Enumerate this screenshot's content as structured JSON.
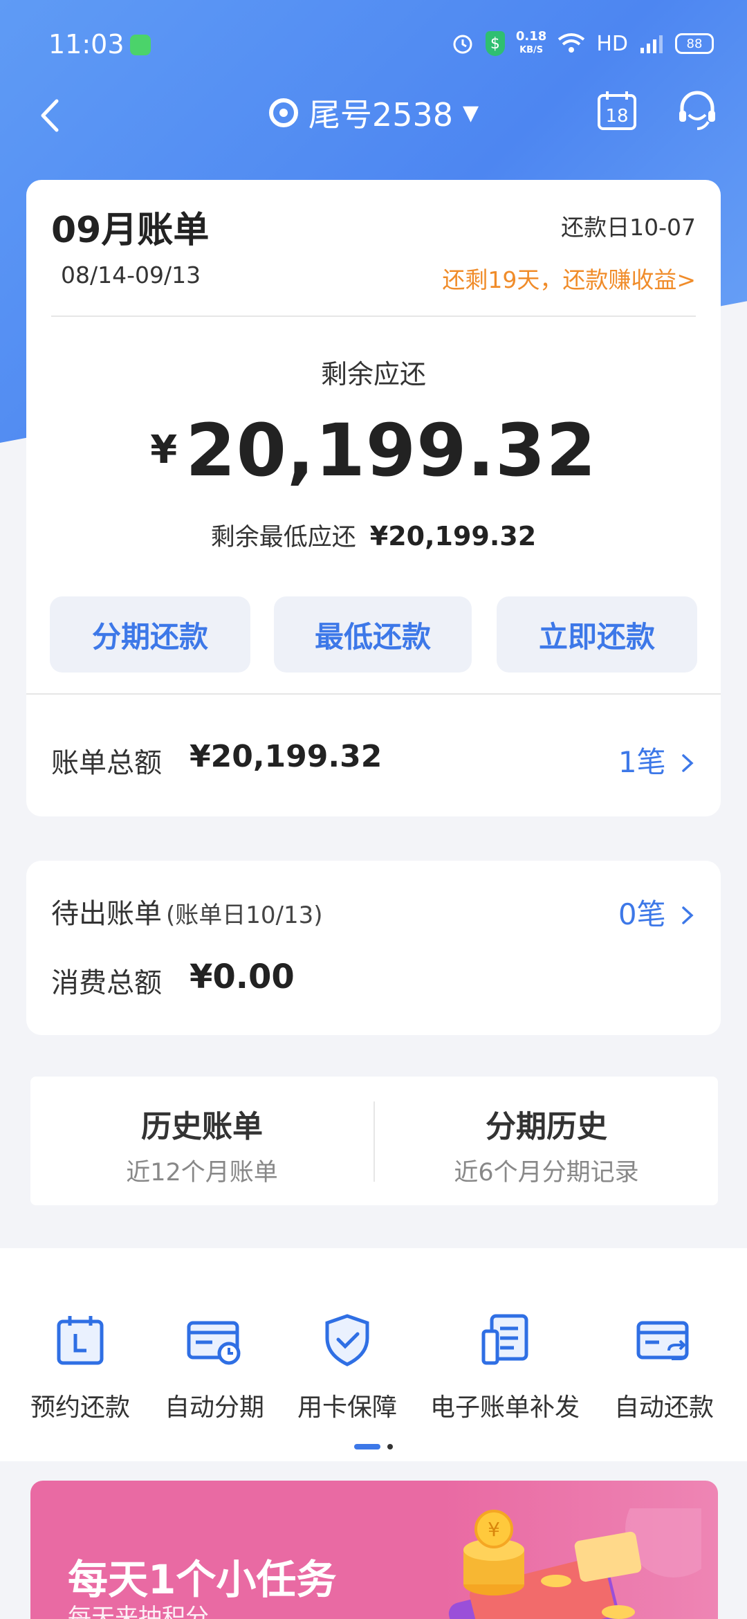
{
  "status": {
    "time": "11:03",
    "speed_value": "0.18",
    "speed_unit": "KB/S",
    "network": "HD",
    "battery": "88"
  },
  "nav": {
    "title": "尾号2538"
  },
  "bill": {
    "month": "09月账单",
    "period": "08/14-09/13",
    "due_date": "还款日10-07",
    "due_reminder": "还剩19天，还款赚收益>",
    "remaining_label": "剩余应还",
    "currency": "¥",
    "remaining_amount": "20,199.32",
    "min_label": "剩余最低应还",
    "min_amount": "¥20,199.32",
    "buttons": {
      "installment": "分期还款",
      "minimum": "最低还款",
      "immediate": "立即还款"
    },
    "total_label": "账单总额",
    "total_amount": "¥20,199.32",
    "count": "1笔"
  },
  "pending": {
    "title": "待出账单",
    "sub": "(账单日10/13)",
    "count": "0笔",
    "spend_label": "消费总额",
    "spend_amount": "¥0.00"
  },
  "history": {
    "bills_title": "历史账单",
    "bills_sub": "近12个月账单",
    "installments_title": "分期历史",
    "installments_sub": "近6个月分期记录"
  },
  "tools": [
    {
      "label": "预约还款",
      "icon": "calendar-icon"
    },
    {
      "label": "自动分期",
      "icon": "card-clock-icon"
    },
    {
      "label": "用卡保障",
      "icon": "shield-check-icon"
    },
    {
      "label": "电子账单补发",
      "icon": "document-icon"
    },
    {
      "label": "自动还款",
      "icon": "card-cycle-icon"
    }
  ],
  "banner": {
    "title": "每天1个小任务",
    "subtitle": "每天来抽积分"
  },
  "colors": {
    "accent_blue": "#3d78e8",
    "hero_blue": "#4d86f1",
    "orange": "#f08c2a",
    "banner_pink": "#e96aa3"
  }
}
